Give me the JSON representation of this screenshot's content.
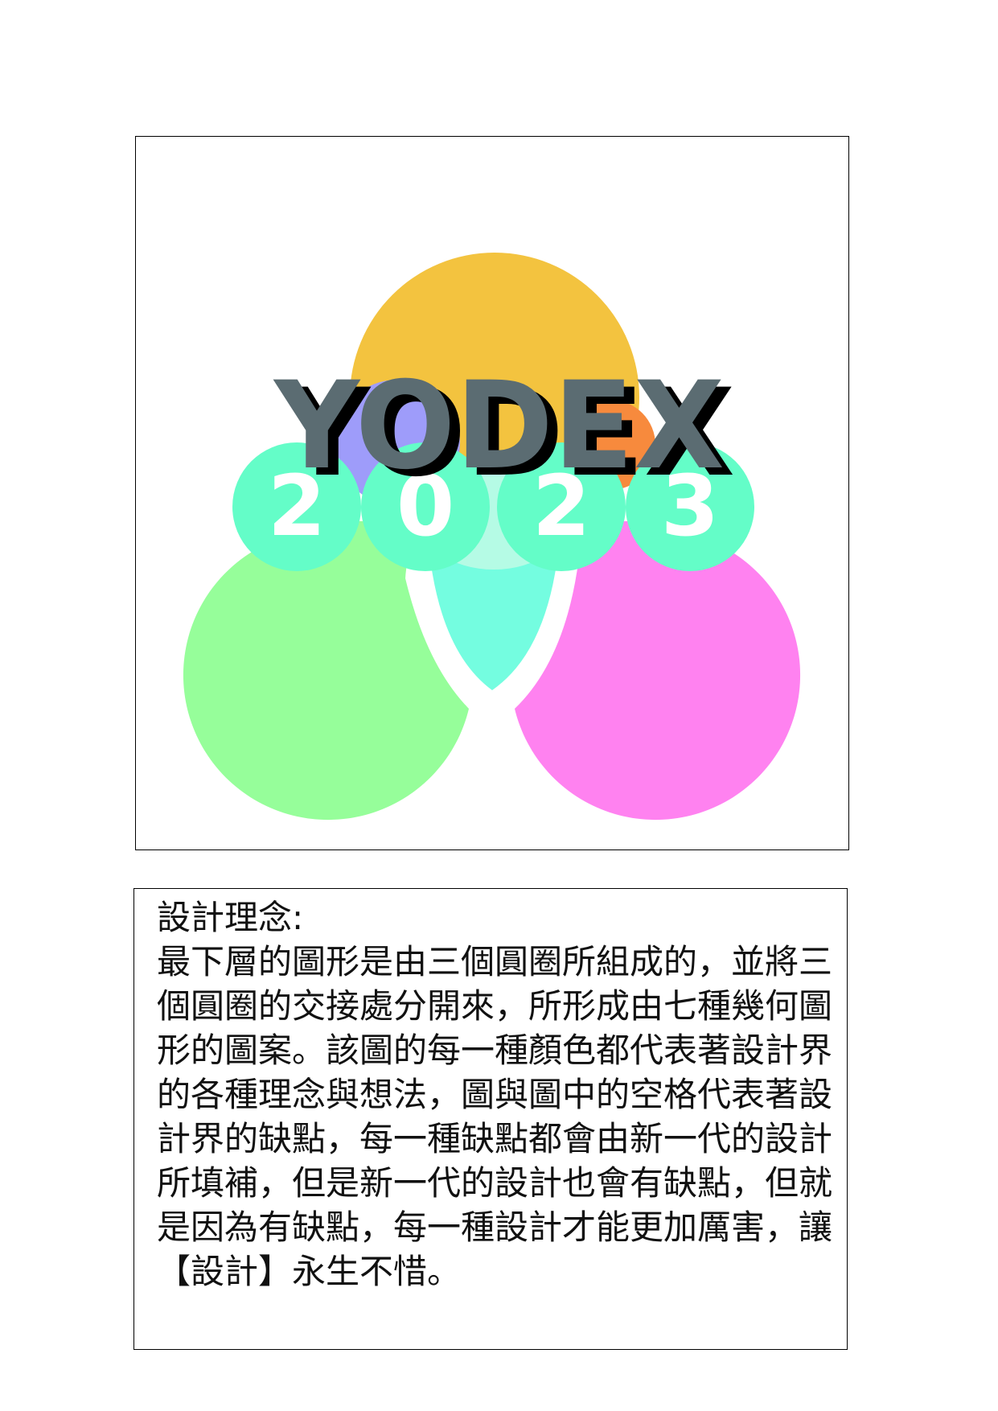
{
  "logo": {
    "word": "YODEX",
    "year_digits": [
      "2",
      "0",
      "2",
      "3"
    ],
    "colors": {
      "top_circle": "#f3c33f",
      "left_circle": "#96fe9a",
      "right_circle": "#ff82f0",
      "center_shield": "#74fde0",
      "violet_segment": "#9e9cfa",
      "orange_segment": "#f78a3d",
      "year_circle": "#64fdc8",
      "word_fill": "#5b6c72",
      "word_shadow": "#000000"
    }
  },
  "concept": {
    "title": "設計理念:",
    "body": "最下層的圖形是由三個圓圈所組成的，並將三個圓圈的交接處分開來，所形成由七種幾何圖形的圖案。該圖的每一種顏色都代表著設計界的各種理念與想法，圖與圖中的空格代表著設計界的缺點，每一種缺點都會由新一代的設計所填補，但是新一代的設計也會有缺點，但就是因為有缺點，每一種設計才能更加厲害，讓【設計】永生不惜。"
  }
}
